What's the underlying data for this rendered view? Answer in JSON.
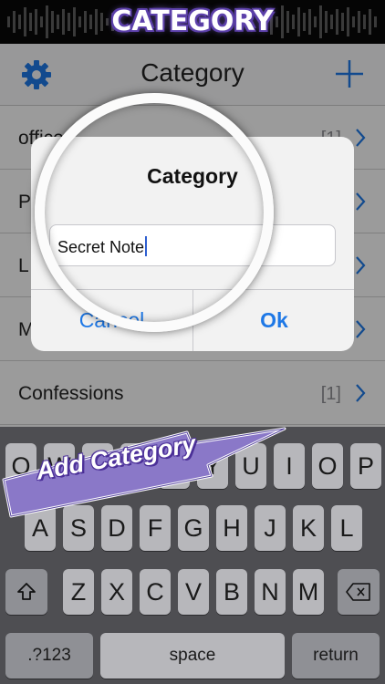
{
  "banner": {
    "title": "CATEGORY"
  },
  "navbar": {
    "title": "Category",
    "settings_icon": "gear-icon",
    "add_icon": "plus-icon"
  },
  "rows": [
    {
      "label": "office",
      "count": "[1]"
    },
    {
      "label": "P",
      "count": ""
    },
    {
      "label": "L",
      "count": ""
    },
    {
      "label": "M",
      "count": ""
    },
    {
      "label": "Confessions",
      "count": "[1]"
    }
  ],
  "alert": {
    "title": "Category",
    "input_value": "Secret Note",
    "cancel_label": "Cancel",
    "ok_label": "Ok"
  },
  "keyboard": {
    "row1": [
      "Q",
      "W",
      "E",
      "R",
      "T",
      "Y",
      "U",
      "I",
      "O",
      "P"
    ],
    "row2": [
      "A",
      "S",
      "D",
      "F",
      "G",
      "H",
      "J",
      "K",
      "L"
    ],
    "row3": [
      "Z",
      "X",
      "C",
      "V",
      "B",
      "N",
      "M"
    ],
    "numbers_label": ".?123",
    "space_label": "space",
    "return_label": "return",
    "shift_icon": "shift-icon",
    "delete_icon": "backspace-icon"
  },
  "promo": {
    "ribbon_text": "Add Category"
  },
  "colors": {
    "accent": "#1e78e6",
    "banner_glow": "#6a4fb8",
    "ribbon": "#8a78c8"
  }
}
